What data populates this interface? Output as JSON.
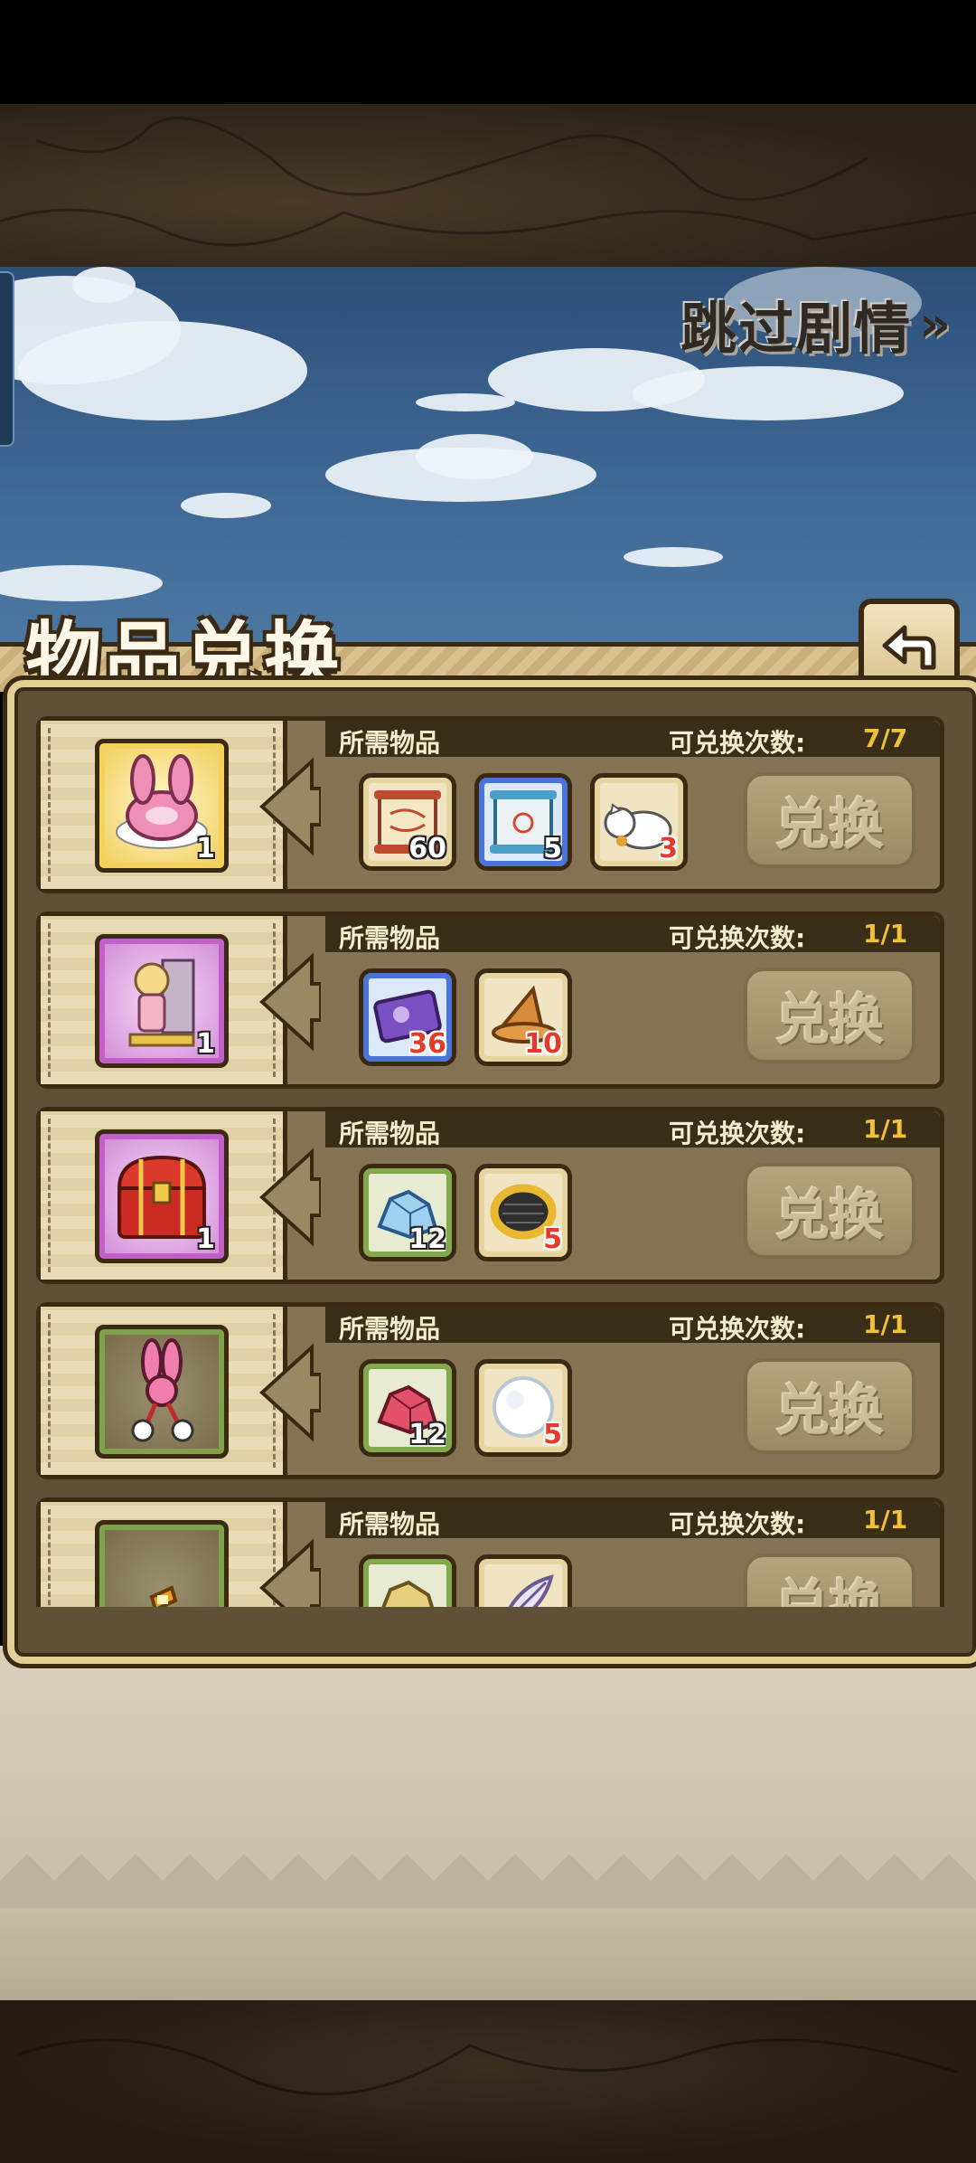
{
  "header": {
    "skip_label": "跳过剧情",
    "skip_icon": "»"
  },
  "panel": {
    "title": "物品兑换",
    "back_icon": "return-arrow-icon"
  },
  "rows": [
    {
      "reward": {
        "icon": "pink-bunny-ring-icon",
        "qty": "1",
        "rarity": "gold"
      },
      "required_label": "所需物品",
      "count_label": "可兑换次数:",
      "count_value": "7/7",
      "costs": [
        {
          "icon": "red-scroll-icon",
          "qty": "60",
          "frame": "tan",
          "qty_color": "white"
        },
        {
          "icon": "blue-scroll-icon",
          "qty": "5",
          "frame": "blue",
          "qty_color": "white"
        },
        {
          "icon": "white-cat-icon",
          "qty": "3",
          "frame": "tan",
          "qty_color": "red"
        }
      ],
      "button": "兑换"
    },
    {
      "reward": {
        "icon": "character-figure-icon",
        "qty": "1",
        "rarity": "purple"
      },
      "required_label": "所需物品",
      "count_label": "可兑换次数:",
      "count_value": "1/1",
      "costs": [
        {
          "icon": "purple-ticket-icon",
          "qty": "36",
          "frame": "blue",
          "qty_color": "red"
        },
        {
          "icon": "witch-hat-icon",
          "qty": "10",
          "frame": "tan",
          "qty_color": "red"
        }
      ],
      "button": "兑换"
    },
    {
      "reward": {
        "icon": "red-treasure-chest-icon",
        "qty": "1",
        "rarity": "purple"
      },
      "required_label": "所需物品",
      "count_label": "可兑换次数:",
      "count_value": "1/1",
      "costs": [
        {
          "icon": "blue-crystal-icon",
          "qty": "12",
          "frame": "green",
          "qty_color": "white"
        },
        {
          "icon": "golden-ring-icon",
          "qty": "5",
          "frame": "tan",
          "qty_color": "red"
        }
      ],
      "button": "兑换"
    },
    {
      "reward": {
        "icon": "bunny-pompom-ornament-icon",
        "qty": "",
        "rarity": "green"
      },
      "required_label": "所需物品",
      "count_label": "可兑换次数:",
      "count_value": "1/1",
      "costs": [
        {
          "icon": "red-crystal-icon",
          "qty": "12",
          "frame": "green",
          "qty_color": "white"
        },
        {
          "icon": "white-fluff-ball-icon",
          "qty": "5",
          "frame": "tan",
          "qty_color": "red"
        }
      ],
      "button": "兑换"
    },
    {
      "reward": {
        "icon": "orange-ribbon-icon",
        "qty": "",
        "rarity": "green"
      },
      "required_label": "所需物品",
      "count_label": "可兑换次数:",
      "count_value": "1/1",
      "costs": [
        {
          "icon": "gold-ore-icon",
          "qty": "",
          "frame": "green",
          "qty_color": "white"
        },
        {
          "icon": "feather-icon",
          "qty": "",
          "frame": "tan",
          "qty_color": "red"
        }
      ],
      "button": "兑换"
    }
  ]
}
